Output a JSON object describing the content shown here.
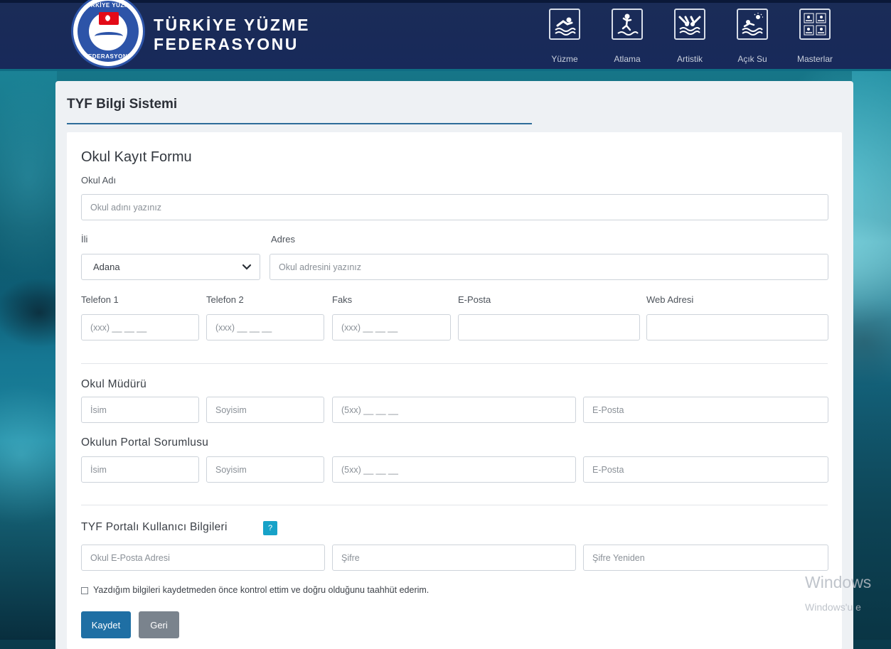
{
  "header": {
    "brand_line1": "TÜRKİYE YÜZME",
    "brand_line2": "FEDERASYONU",
    "logo_top_text": "TÜRKİYE YÜZME",
    "logo_bottom_text": "FEDERASYONU",
    "nav": [
      {
        "label": "Yüzme",
        "icon": "swimmer-icon"
      },
      {
        "label": "Atlama",
        "icon": "diver-icon"
      },
      {
        "label": "Artistik",
        "icon": "synchronized-swimming-icon"
      },
      {
        "label": "Açık Su",
        "icon": "open-water-icon"
      },
      {
        "label": "Masterlar",
        "icon": "masters-icon"
      }
    ]
  },
  "panel": {
    "title": "TYF Bilgi Sistemi"
  },
  "form": {
    "heading": "Okul Kayıt Formu",
    "school_name": {
      "label": "Okul Adı",
      "placeholder": "Okul adını yazınız",
      "value": ""
    },
    "city": {
      "label": "İli",
      "value": "Adana"
    },
    "address": {
      "label": "Adres",
      "placeholder": "Okul adresini yazınız",
      "value": ""
    },
    "phone1": {
      "label": "Telefon 1",
      "placeholder": "(xxx) __ __ __"
    },
    "phone2": {
      "label": "Telefon 2",
      "placeholder": "(xxx) __ __ __"
    },
    "fax": {
      "label": "Faks",
      "placeholder": "(xxx) __ __ __"
    },
    "email": {
      "label": "E-Posta",
      "placeholder": ""
    },
    "web": {
      "label": "Web Adresi",
      "placeholder": ""
    },
    "principal": {
      "heading": "Okul Müdürü",
      "first_name": "İsim",
      "last_name": "Soyisim",
      "phone": "(5xx) __ __ __",
      "email": "E-Posta"
    },
    "portal_manager": {
      "heading": "Okulun Portal Sorumlusu",
      "first_name": "İsim",
      "last_name": "Soyisim",
      "phone": "(5xx) __ __ __",
      "email": "E-Posta"
    },
    "portal_user": {
      "heading": "TYF Portalı Kullanıcı Bilgileri",
      "help": "?",
      "email": "Okul E-Posta Adresi",
      "password": "Şifre",
      "password_repeat": "Şifre Yeniden"
    },
    "consent_text": "Yazdığım bilgileri kaydetmeden önce kontrol ettim ve doğru olduğunu taahhüt ederim.",
    "save_label": "Kaydet",
    "back_label": "Geri"
  },
  "watermark": {
    "line1": "Windows",
    "line2": "Windows'u e"
  }
}
